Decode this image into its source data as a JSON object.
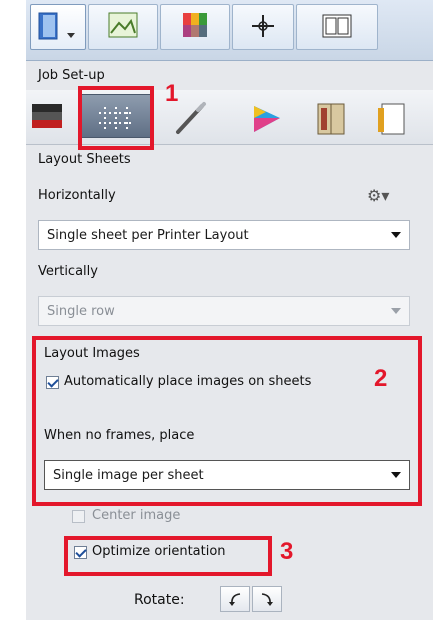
{
  "panel": {
    "heading": "Job Set-up"
  },
  "top_tabs": [
    {
      "icon": "book-icon"
    },
    {
      "icon": "image-frame-icon"
    },
    {
      "icon": "color-swatches-icon"
    },
    {
      "icon": "crosshair-icon"
    },
    {
      "icon": "layout-icon"
    }
  ],
  "job_icons": [
    {
      "icon": "printer-icon"
    },
    {
      "icon": "layout-grid-icon"
    },
    {
      "icon": "brush-icon"
    },
    {
      "icon": "color-triangle-icon"
    },
    {
      "icon": "book-icon"
    },
    {
      "icon": "document-icon"
    }
  ],
  "layout_sheets": {
    "title": "Layout Sheets",
    "horizontally_label": "Horizontally",
    "horizontally_value": "Single sheet per Printer Layout",
    "vertically_label": "Vertically",
    "vertically_value": "Single row"
  },
  "layout_images": {
    "title": "Layout Images",
    "auto_place_label": "Automatically place images on sheets",
    "auto_place_checked": true,
    "no_frames_label": "When no frames, place",
    "no_frames_value": "Single image per sheet"
  },
  "options": {
    "center_image_label": "Center image",
    "center_image_checked": false,
    "optimize_label": "Optimize orientation",
    "optimize_checked": true,
    "rotate_label": "Rotate:",
    "rotate_left_icon": "rotate-left-icon",
    "rotate_right_icon": "rotate-right-icon"
  },
  "annotations": {
    "one": "1",
    "two": "2",
    "three": "3"
  },
  "colors": {
    "annotation_red": "#e3172b"
  }
}
